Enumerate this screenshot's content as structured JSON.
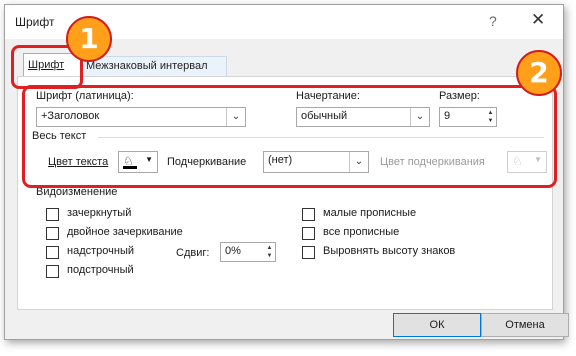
{
  "window": {
    "title": "Шрифт",
    "help": "?",
    "close": "✕"
  },
  "tabs": [
    {
      "label": "Шрифт",
      "active": true
    },
    {
      "label": "Межзнаковый интервал",
      "active": false
    }
  ],
  "font": {
    "latin_label": "Шрифт (латиница):",
    "latin_value": "+Заголовок",
    "style_label": "Начертание:",
    "style_value": "обычный",
    "size_label": "Размер:",
    "size_value": "9"
  },
  "all_text": {
    "section_label": "Весь текст",
    "color_label": "Цвет текста",
    "underline_label": "Подчеркивание",
    "underline_value": "(нет)",
    "underline_color_label": "Цвет подчеркивания"
  },
  "effects": {
    "section_label": "Видоизменение",
    "strikethrough": "зачеркнутый",
    "double_strikethrough": "двойное зачеркивание",
    "superscript": "надстрочный",
    "subscript": "подстрочный",
    "offset_label": "Сдвиг:",
    "offset_value": "0%",
    "small_caps": "малые прописные",
    "all_caps": "все прописные",
    "equalize_height": "Выровнять высоту знаков"
  },
  "buttons": {
    "ok": "ОК",
    "cancel": "Отмена"
  },
  "annotations": {
    "badge1": "1",
    "badge2": "2"
  },
  "colors": {
    "annotation_red": "#e02020",
    "badge_orange": "#ff9f1a",
    "ok_border": "#0078d7"
  }
}
